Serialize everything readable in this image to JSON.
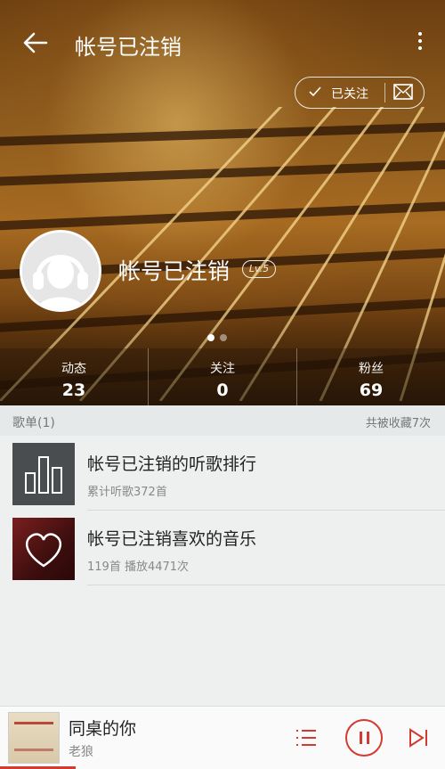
{
  "header": {
    "title": "帐号已注销",
    "follow_label": "已关注"
  },
  "profile": {
    "username": "帐号已注销",
    "level": "Lv.5"
  },
  "stats": [
    {
      "label": "动态",
      "value": "23"
    },
    {
      "label": "关注",
      "value": "0"
    },
    {
      "label": "粉丝",
      "value": "69"
    }
  ],
  "playlists_section": {
    "title": "歌单(1)",
    "collected": "共被收藏7次"
  },
  "playlists": [
    {
      "name": "帐号已注销的听歌排行",
      "meta": "累计听歌372首",
      "icon": "bar-chart-icon"
    },
    {
      "name": "帐号已注销喜欢的音乐",
      "meta": "119首 播放4471次",
      "icon": "heart-icon"
    }
  ],
  "player": {
    "song": "同桌的你",
    "artist": "老狼",
    "progress": 0.17
  },
  "colors": {
    "accent": "#d33a31"
  }
}
